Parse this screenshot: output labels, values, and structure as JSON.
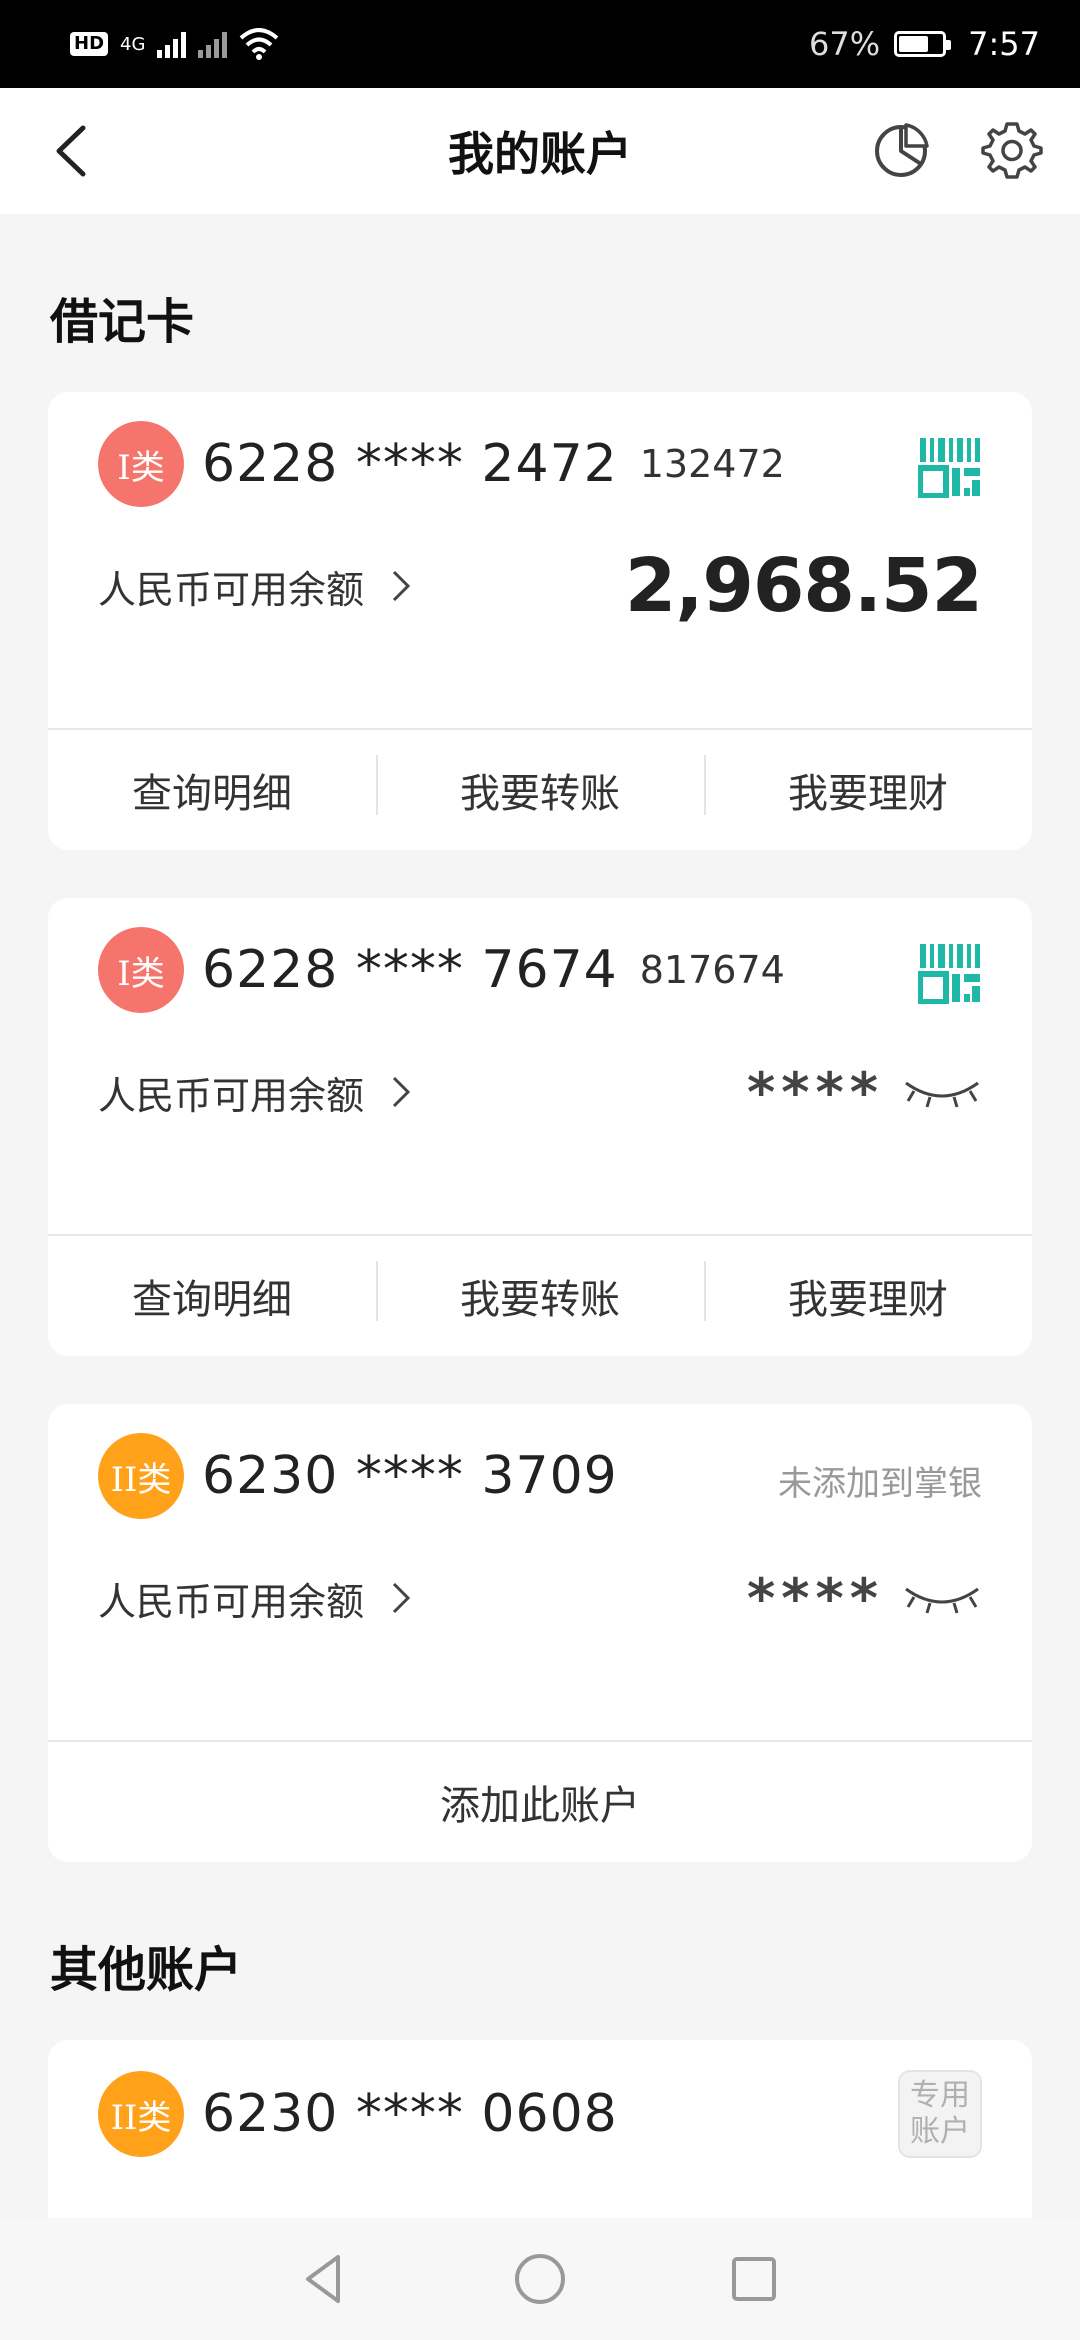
{
  "status_bar": {
    "hd_label": "HD",
    "network_label": "4G",
    "battery_percent": "67%",
    "time": "7:57"
  },
  "header": {
    "title": "我的账户"
  },
  "debit_section_title": "借记卡",
  "other_section_title": "其他账户",
  "cards": [
    {
      "class_label": "I类",
      "number": "6228 **** 2472",
      "suffix": "132472",
      "balance_label": "人民币可用余额",
      "balance": "2,968.52",
      "actions": [
        "查询明细",
        "我要转账",
        "我要理财"
      ]
    },
    {
      "class_label": "I类",
      "number": "6228 **** 7674",
      "suffix": "817674",
      "balance_label": "人民币可用余额",
      "balance_masked": "****",
      "actions": [
        "查询明细",
        "我要转账",
        "我要理财"
      ]
    },
    {
      "class_label": "II类",
      "number": "6230 **** 3709",
      "status": "未添加到掌银",
      "balance_label": "人民币可用余额",
      "balance_masked": "****",
      "action": "添加此账户"
    }
  ],
  "other_accounts": [
    {
      "class_label": "II类",
      "number": "6230 **** 0608",
      "tag_line1": "专用",
      "tag_line2": "账户"
    }
  ],
  "colors": {
    "class1_badge": "#f5756c",
    "class2_badge": "#ffa21a",
    "qr_icon": "#1fb8a6"
  }
}
